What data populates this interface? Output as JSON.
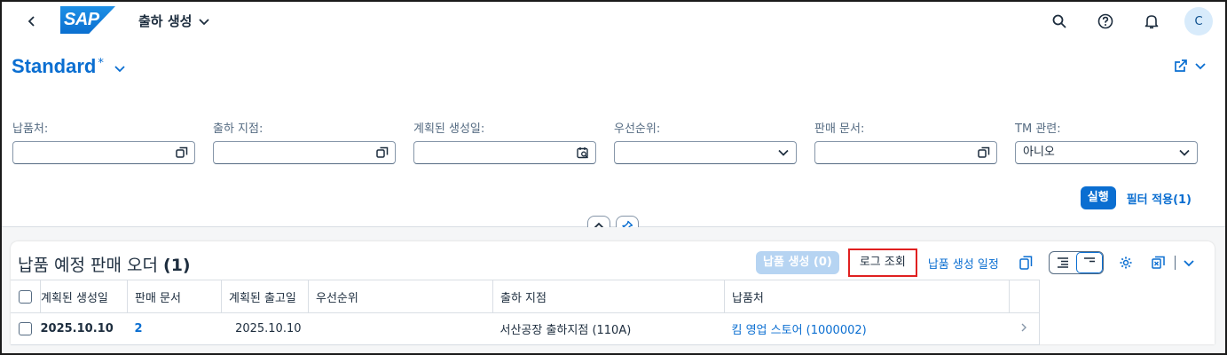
{
  "shell": {
    "logo_text": "SAP",
    "app_title": "출하 생성",
    "avatar_initial": "C"
  },
  "variant": {
    "name": "Standard",
    "modified_marker": "*"
  },
  "filters": [
    {
      "label": "납품처:",
      "value": "",
      "icon": "value-help-icon"
    },
    {
      "label": "출하 지점:",
      "value": "",
      "icon": "value-help-icon"
    },
    {
      "label": "계획된 생성일:",
      "value": "",
      "icon": "calendar-icon"
    },
    {
      "label": "우선순위:",
      "value": "",
      "icon": "chevron-down-icon"
    },
    {
      "label": "판매 문서:",
      "value": "",
      "icon": "value-help-icon"
    },
    {
      "label": "TM 관련:",
      "value": "아니오",
      "icon": "chevron-down-icon"
    }
  ],
  "filter_bar": {
    "go_label": "실행",
    "adapt_label": "필터 적용(1)"
  },
  "table": {
    "title": "납품 예정 판매 오더",
    "count": "(1)",
    "toolbar": {
      "create_delivery": "납품 생성 (0)",
      "view_log": "로그 조회",
      "schedule": "납품 생성 일정"
    },
    "columns": [
      "계획된 생성일",
      "판매 문서",
      "계획된 출고일",
      "우선순위",
      "출하 지점",
      "납품처"
    ],
    "rows": [
      {
        "creation_date": "2025.10.10",
        "sales_document": "2",
        "goods_issue_date": "2025.10.10",
        "priority": "",
        "shipping_point": "서산공장 출하지점 (110A)",
        "ship_to": "킴 영업 스토어 (1000002)"
      }
    ]
  },
  "colors": {
    "accent": "#0a6ed1",
    "highlight_border": "#e02020"
  }
}
